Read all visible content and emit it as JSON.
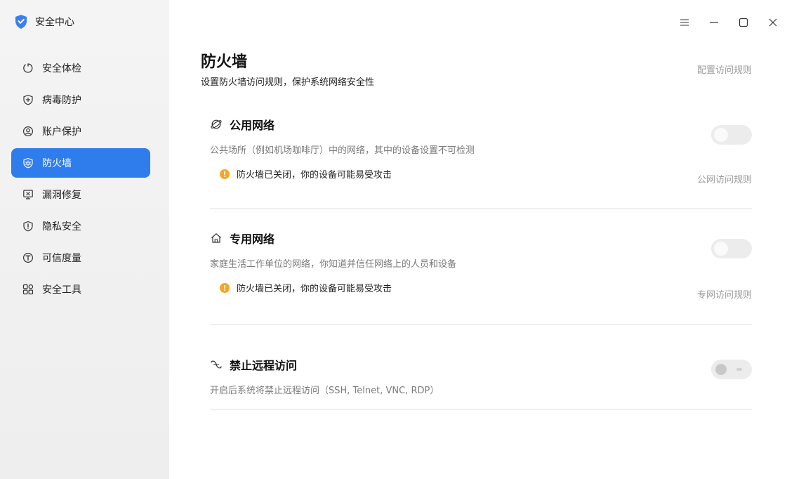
{
  "app": {
    "name": "安全中心",
    "logo_icon": "shield-logo-icon",
    "accent": "#2f7ded"
  },
  "sidebar": {
    "items": [
      {
        "label": "安全体检",
        "icon": "checkup-icon",
        "active": false
      },
      {
        "label": "病毒防护",
        "icon": "virus-shield-icon",
        "active": false
      },
      {
        "label": "账户保护",
        "icon": "account-icon",
        "active": false
      },
      {
        "label": "防火墙",
        "icon": "firewall-icon",
        "active": true
      },
      {
        "label": "漏洞修复",
        "icon": "vulnerability-icon",
        "active": false
      },
      {
        "label": "隐私安全",
        "icon": "privacy-icon",
        "active": false
      },
      {
        "label": "可信度量",
        "icon": "trust-icon",
        "active": false
      },
      {
        "label": "安全工具",
        "icon": "tools-icon",
        "active": false
      }
    ]
  },
  "window_controls": {
    "menu": "menu-icon",
    "minimize": "minimize-icon",
    "maximize": "maximize-icon",
    "close": "close-icon"
  },
  "page": {
    "title": "防火墙",
    "subtitle": "设置防火墙访问规则，保护系统网络安全性",
    "config_link": "配置访问规则"
  },
  "public_network": {
    "title": "公用网络",
    "icon": "planet-icon",
    "description": "公共场所（例如机场咖啡厅）中的网络，其中的设备设置不可检测",
    "warning": "防火墙已关闭，你的设备可能易受攻击",
    "rule_link": "公网访问规则",
    "enabled": false
  },
  "private_network": {
    "title": "专用网络",
    "icon": "home-icon",
    "description": "家庭生活工作单位的网络，你知道并信任网络上的人员和设备",
    "warning": "防火墙已关闭，你的设备可能易受攻击",
    "rule_link": "专网访问规则",
    "enabled": false
  },
  "remote_access": {
    "title": "禁止远程访问",
    "icon": "remote-link-icon",
    "description": "开启后系统将禁止远程访问（SSH, Telnet, VNC, RDP）",
    "enabled": false,
    "disabled": true
  },
  "colors": {
    "warning": "#f5a623",
    "muted_text": "#9a9a9a",
    "active_nav": "#2f7ded"
  }
}
